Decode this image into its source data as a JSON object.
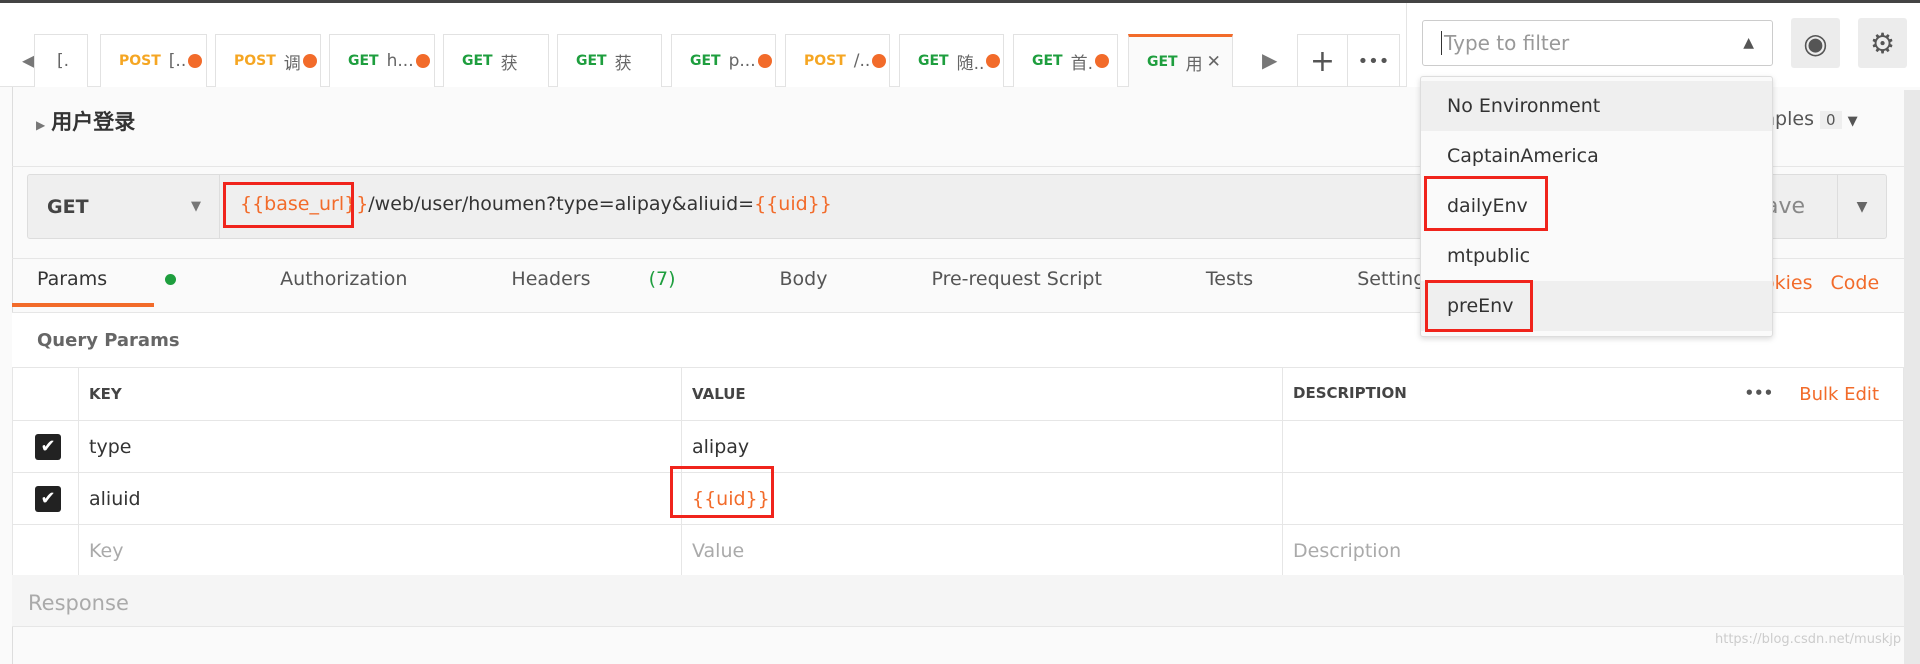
{
  "tabs": [
    {
      "method": "",
      "label": "[.",
      "dirty": false
    },
    {
      "method": "POST",
      "label": "[..",
      "dirty": true
    },
    {
      "method": "POST",
      "label": "调",
      "dirty": true
    },
    {
      "method": "GET",
      "label": "h...",
      "dirty": true
    },
    {
      "method": "GET",
      "label": "获",
      "dirty": false
    },
    {
      "method": "GET",
      "label": "获",
      "dirty": false
    },
    {
      "method": "GET",
      "label": "p...",
      "dirty": true
    },
    {
      "method": "POST",
      "label": "/..",
      "dirty": true
    },
    {
      "method": "GET",
      "label": "随..",
      "dirty": true
    },
    {
      "method": "GET",
      "label": "首.",
      "dirty": true
    },
    {
      "method": "GET",
      "label": "用",
      "dirty": false,
      "active": true
    }
  ],
  "tab_close": "✕",
  "env_filter": {
    "placeholder": "Type to filter",
    "options": [
      "No Environment",
      "CaptainAmerica",
      "dailyEnv",
      "mtpublic",
      "preEnv"
    ]
  },
  "request": {
    "name": "用户登录",
    "method": "GET",
    "url_prefix_var": "{{base_url}}",
    "url_path": "/web/user/houmen?type=alipay&aliuid=",
    "url_suffix_var": "{{uid}}",
    "save": "Save",
    "examples_label": "nples",
    "examples_count": "0"
  },
  "req_tabs": [
    {
      "label": "Params",
      "dot": true
    },
    {
      "label": "Authorization"
    },
    {
      "label": "Headers",
      "count": "(7)"
    },
    {
      "label": "Body"
    },
    {
      "label": "Pre-request Script"
    },
    {
      "label": "Tests"
    },
    {
      "label": "Settings"
    }
  ],
  "links": {
    "cookies": "okies",
    "code": "Code"
  },
  "query": {
    "title": "Query Params",
    "headers": [
      "KEY",
      "VALUE",
      "DESCRIPTION"
    ],
    "bulk_edit": "Bulk Edit",
    "rows": [
      {
        "key": "type",
        "value": "alipay",
        "checked": true
      },
      {
        "key": "aliuid",
        "value": "{{uid}}",
        "checked": true
      }
    ],
    "placeholders": {
      "key": "Key",
      "value": "Value",
      "description": "Description"
    }
  },
  "response": "Response",
  "watermark": "https://blog.csdn.net/muskjp",
  "colors": {
    "accent": "#f26b2a",
    "get": "#1e9e3e",
    "post": "#f5a623",
    "highlight": "#f0241c"
  }
}
